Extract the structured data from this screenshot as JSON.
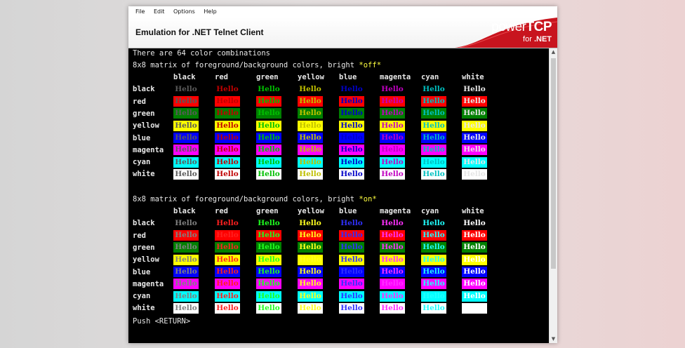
{
  "menu": [
    "File",
    "Edit",
    "Options",
    "Help"
  ],
  "window_title": "Emulation for .NET Telnet Client",
  "logo": {
    "power": "power",
    "tcp": "TCP",
    "for": "for",
    "net": ".NET"
  },
  "terminal": {
    "line1": "There are 64 color combinations",
    "matrix_off_title": "8x8 matrix of foreground/background colors, bright ",
    "matrix_off_flag": "*off*",
    "matrix_on_title": "8x8 matrix of foreground/background colors, bright ",
    "matrix_on_flag": "*on*",
    "push": "Push <RETURN>",
    "cell_text": "Hello",
    "columns": [
      "black",
      "red",
      "green",
      "yellow",
      "blue",
      "magenta",
      "cyan",
      "white"
    ],
    "rows": [
      "black",
      "red",
      "green",
      "yellow",
      "blue",
      "magenta",
      "cyan",
      "white"
    ]
  },
  "palette": {
    "off_fg": [
      "#5a5a5a",
      "#c00000",
      "#00c000",
      "#c0c000",
      "#0000c8",
      "#c000c0",
      "#00c0c0",
      "#e6e6e6"
    ],
    "off_bg": [
      "#000000",
      "#ff0000",
      "#008000",
      "#ffff00",
      "#0000ff",
      "#ff00ff",
      "#00ffff",
      "#ffffff"
    ],
    "on_fg": [
      "#808080",
      "#ff2020",
      "#20ff20",
      "#ffff20",
      "#3030ff",
      "#ff30ff",
      "#20ffff",
      "#ffffff"
    ],
    "on_bg": [
      "#000000",
      "#ff0000",
      "#008000",
      "#ffff00",
      "#0000ff",
      "#ff00ff",
      "#00ffff",
      "#ffffff"
    ],
    "logo_red": "#c8141e",
    "terminal_bg": "#000000"
  }
}
